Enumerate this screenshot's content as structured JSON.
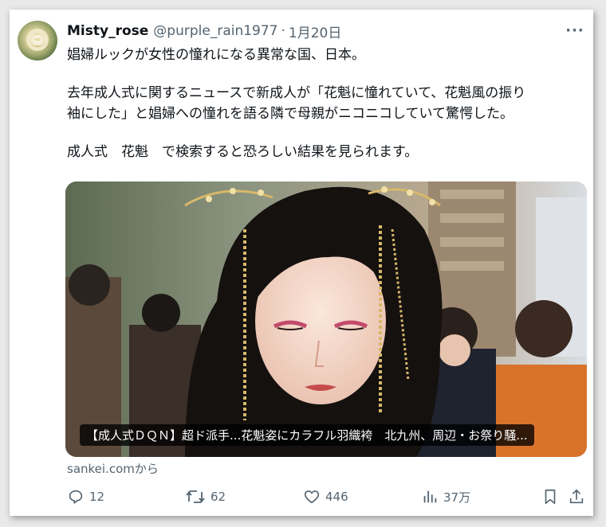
{
  "tweet": {
    "display_name": "Misty_rose",
    "handle": "@purple_rain1977",
    "separator": "·",
    "date": "1月20日",
    "more": "···",
    "lines": [
      "娼婦ルックが女性の憧れになる異常な国、日本。",
      "去年成人式に関するニュースで新成人が「花魁に憧れていて、花魁風の振り",
      "袖にした」と娼婦への憧れを語る隣で母親がニコニコしていて驚愕した。",
      "成人式　花魁　で検索すると恐ろしい結果を見られます。"
    ]
  },
  "card": {
    "caption": "【成人式ＤＱＮ】超ド派手...花魁姿にカラフル羽織袴　北九州、周辺・お祭り騒...",
    "source": "sankei.comから"
  },
  "actions": {
    "reply_count": "12",
    "retweet_count": "62",
    "like_count": "446",
    "view_count": "37万"
  },
  "icons": {
    "reply": "reply-icon",
    "retweet": "retweet-icon",
    "like": "heart-icon",
    "views": "views-icon",
    "bookmark": "bookmark-icon",
    "share": "share-icon"
  },
  "colors": {
    "text": "#0f1419",
    "secondary": "#536471",
    "card_background": "#ffffff"
  }
}
